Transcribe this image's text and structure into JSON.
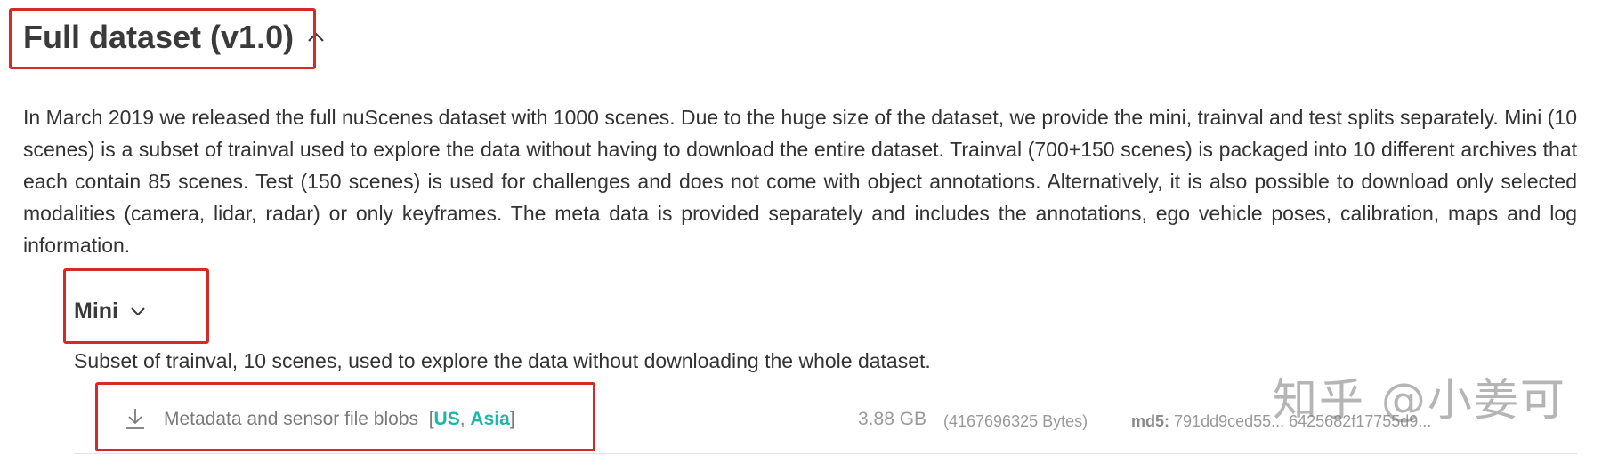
{
  "section": {
    "title": "Full dataset (v1.0)",
    "chevron": "chevron-up-icon"
  },
  "intro": "In March 2019 we released the full nuScenes dataset with 1000 scenes. Due to the huge size of the dataset, we provide the mini, trainval and test splits separately. Mini (10 scenes) is a subset of trainval used to explore the data without having to download the entire dataset. Trainval (700+150 scenes) is packaged into 10 different archives that each contain 85 scenes. Test (150 scenes) is used for challenges and does not come with object annotations. Alternatively, it is also possible to download only selected modalities (camera, lidar, radar) or only keyframes. The meta data is provided separately and includes the annotations, ego vehicle poses, calibration, maps and log information.",
  "mini": {
    "title": "Mini",
    "chevron": "chevron-down-icon",
    "description": "Subset of trainval, 10 scenes, used to explore the data without downloading the whole dataset.",
    "download": {
      "icon": "download-icon",
      "label": "Metadata and sensor file blobs",
      "bracket_open": "[",
      "bracket_close": "]",
      "regions": [
        "US",
        "Asia"
      ],
      "region_separator": ",",
      "size": "3.88 GB",
      "bytes": "(4167696325 Bytes)",
      "md5_label": "md5:",
      "md5_value": "791dd9ced55... 6425682f17755d9..."
    }
  },
  "watermark": "知乎 @小姜可",
  "colors": {
    "accent": "#1fb5ad",
    "annotation": "#d42a2a",
    "heading": "#3a3a3a",
    "muted": "#9a9a9a"
  }
}
